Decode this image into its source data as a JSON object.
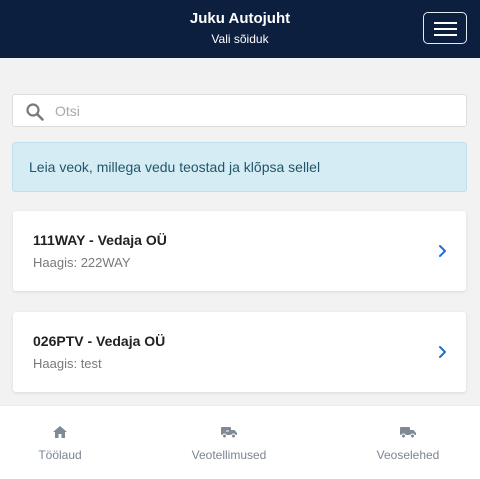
{
  "header": {
    "title": "Juku Autojuht",
    "subtitle": "Vali sõiduk",
    "menu_icon": "hamburger-menu-icon"
  },
  "search": {
    "placeholder": "Otsi",
    "value": "",
    "icon": "search-icon"
  },
  "info": {
    "text": "Leia veok, millega vedu teostad ja klõpsa sellel"
  },
  "vehicles": [
    {
      "title": "111WAY - Vedaja OÜ",
      "trailer": "Haagis: 222WAY"
    },
    {
      "title": "026PTV - Vedaja OÜ",
      "trailer": "Haagis: test"
    }
  ],
  "bottom_nav": {
    "items": [
      {
        "label": "Töölaud",
        "icon": "home-icon"
      },
      {
        "label": "Veotellimused",
        "icon": "truck-icon"
      },
      {
        "label": "Veoselehed",
        "icon": "truck-icon"
      }
    ]
  },
  "colors": {
    "header_bg": "#0d1f3f",
    "accent": "#1f6ed4",
    "info_bg": "#d6ecf4",
    "info_text": "#20566a",
    "page_bg": "#f2f2f2"
  }
}
